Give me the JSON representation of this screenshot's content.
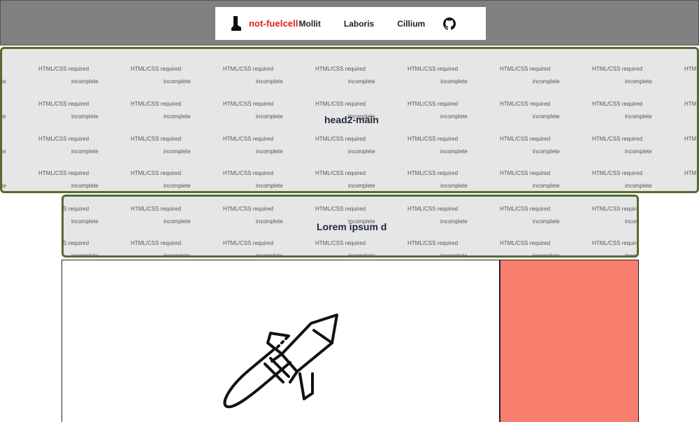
{
  "nav": {
    "brand": "not-fuelcell",
    "links": [
      "Mollit",
      "Laboris",
      "Cillium"
    ],
    "icons": {
      "logo": "boot-icon",
      "repo": "github-icon"
    }
  },
  "pattern": {
    "required": "HTML/CSS required",
    "status": "incomplete"
  },
  "panels": {
    "head2_title": "head2-main",
    "lorem_title": "Lorem ipsum d"
  },
  "hero": {
    "icon": "rocket-icon"
  },
  "colors": {
    "topbar": "#808080",
    "brand": "#e01a1a",
    "panel_bg": "#e6e6e6",
    "panel_border": "#556b2f",
    "side": "#f87f6d"
  }
}
